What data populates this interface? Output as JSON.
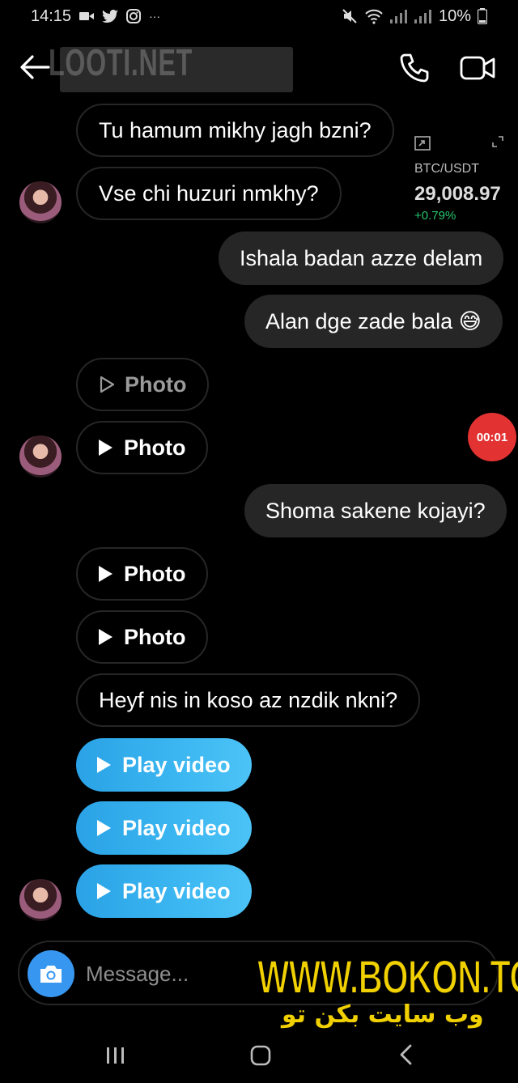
{
  "status_bar": {
    "time": "14:15",
    "dots": "···",
    "battery": "10%"
  },
  "header": {
    "watermark": "LOOTI.NET"
  },
  "crypto_widget": {
    "pair": "BTC/USDT",
    "price": "29,008.97",
    "change": "+0.79%"
  },
  "recording_timer": "00:01",
  "messages": [
    {
      "text": "Tu hamum mikhy jagh bzni?"
    },
    {
      "text": "Vse chi huzuri nmkhy?"
    },
    {
      "text": "Ishala badan azze delam"
    },
    {
      "text": "Alan dge zade bala 😅"
    },
    {
      "text": "Photo"
    },
    {
      "text": "Photo"
    },
    {
      "text": "Shoma sakene kojayi?"
    },
    {
      "text": "Photo"
    },
    {
      "text": "Photo"
    },
    {
      "text": "Heyf nis in koso az nzdik nkni?"
    },
    {
      "text": "Play video"
    },
    {
      "text": "Play video"
    },
    {
      "text": "Play video"
    }
  ],
  "composer": {
    "placeholder": "Message..."
  },
  "watermark_bottom": {
    "url": "WWW.BOKON.TO",
    "persian": "وب سایت بکن تو"
  },
  "colors": {
    "background": "#000000",
    "incoming_border": "#262626",
    "outgoing_bg": "#262626",
    "video_bubble": "#3cb7f1",
    "camera_button": "#3797f0",
    "recording": "#e23232",
    "watermark": "#f1d000",
    "crypto_up": "#27c46a"
  }
}
